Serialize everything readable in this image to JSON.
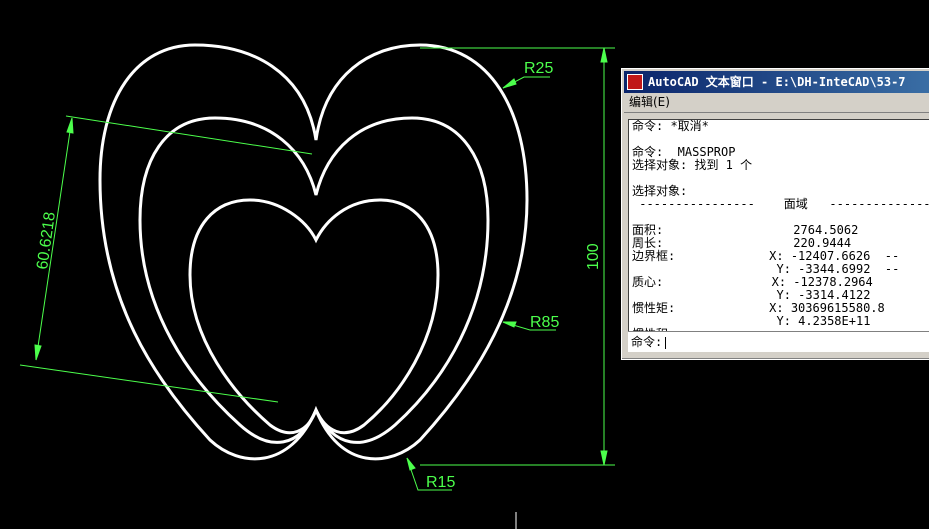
{
  "drawing": {
    "dimensions": {
      "aligned_length": "60.6218",
      "height": "100",
      "r_top": "R25",
      "r_right": "R85",
      "r_bottom": "R15"
    }
  },
  "text_window": {
    "title": "AutoCAD 文本窗口 - E:\\DH-InteCAD\\53-7",
    "menu": [
      "编辑(E)"
    ],
    "lines": [
      "命令: *取消*",
      "",
      "命令:  MASSPROP",
      "选择对象: 找到 1 个",
      "",
      "选择对象:",
      " ----------------    面域   -------------------",
      "",
      "面积:                  2764.5062",
      "周长:                  220.9444",
      "边界框:             X: -12407.6626  --",
      "                    Y: -3344.6992  --",
      "质心:               X: -12378.2964",
      "                    Y: -3314.4122",
      "惯性矩:             X: 30369615580.8",
      "                    Y: 4.2358E+11",
      "惯性积:"
    ],
    "prompt": "命令:"
  },
  "colors": {
    "background": "#000000",
    "geometry": "#ffffff",
    "dimension": "#4cff4c"
  }
}
